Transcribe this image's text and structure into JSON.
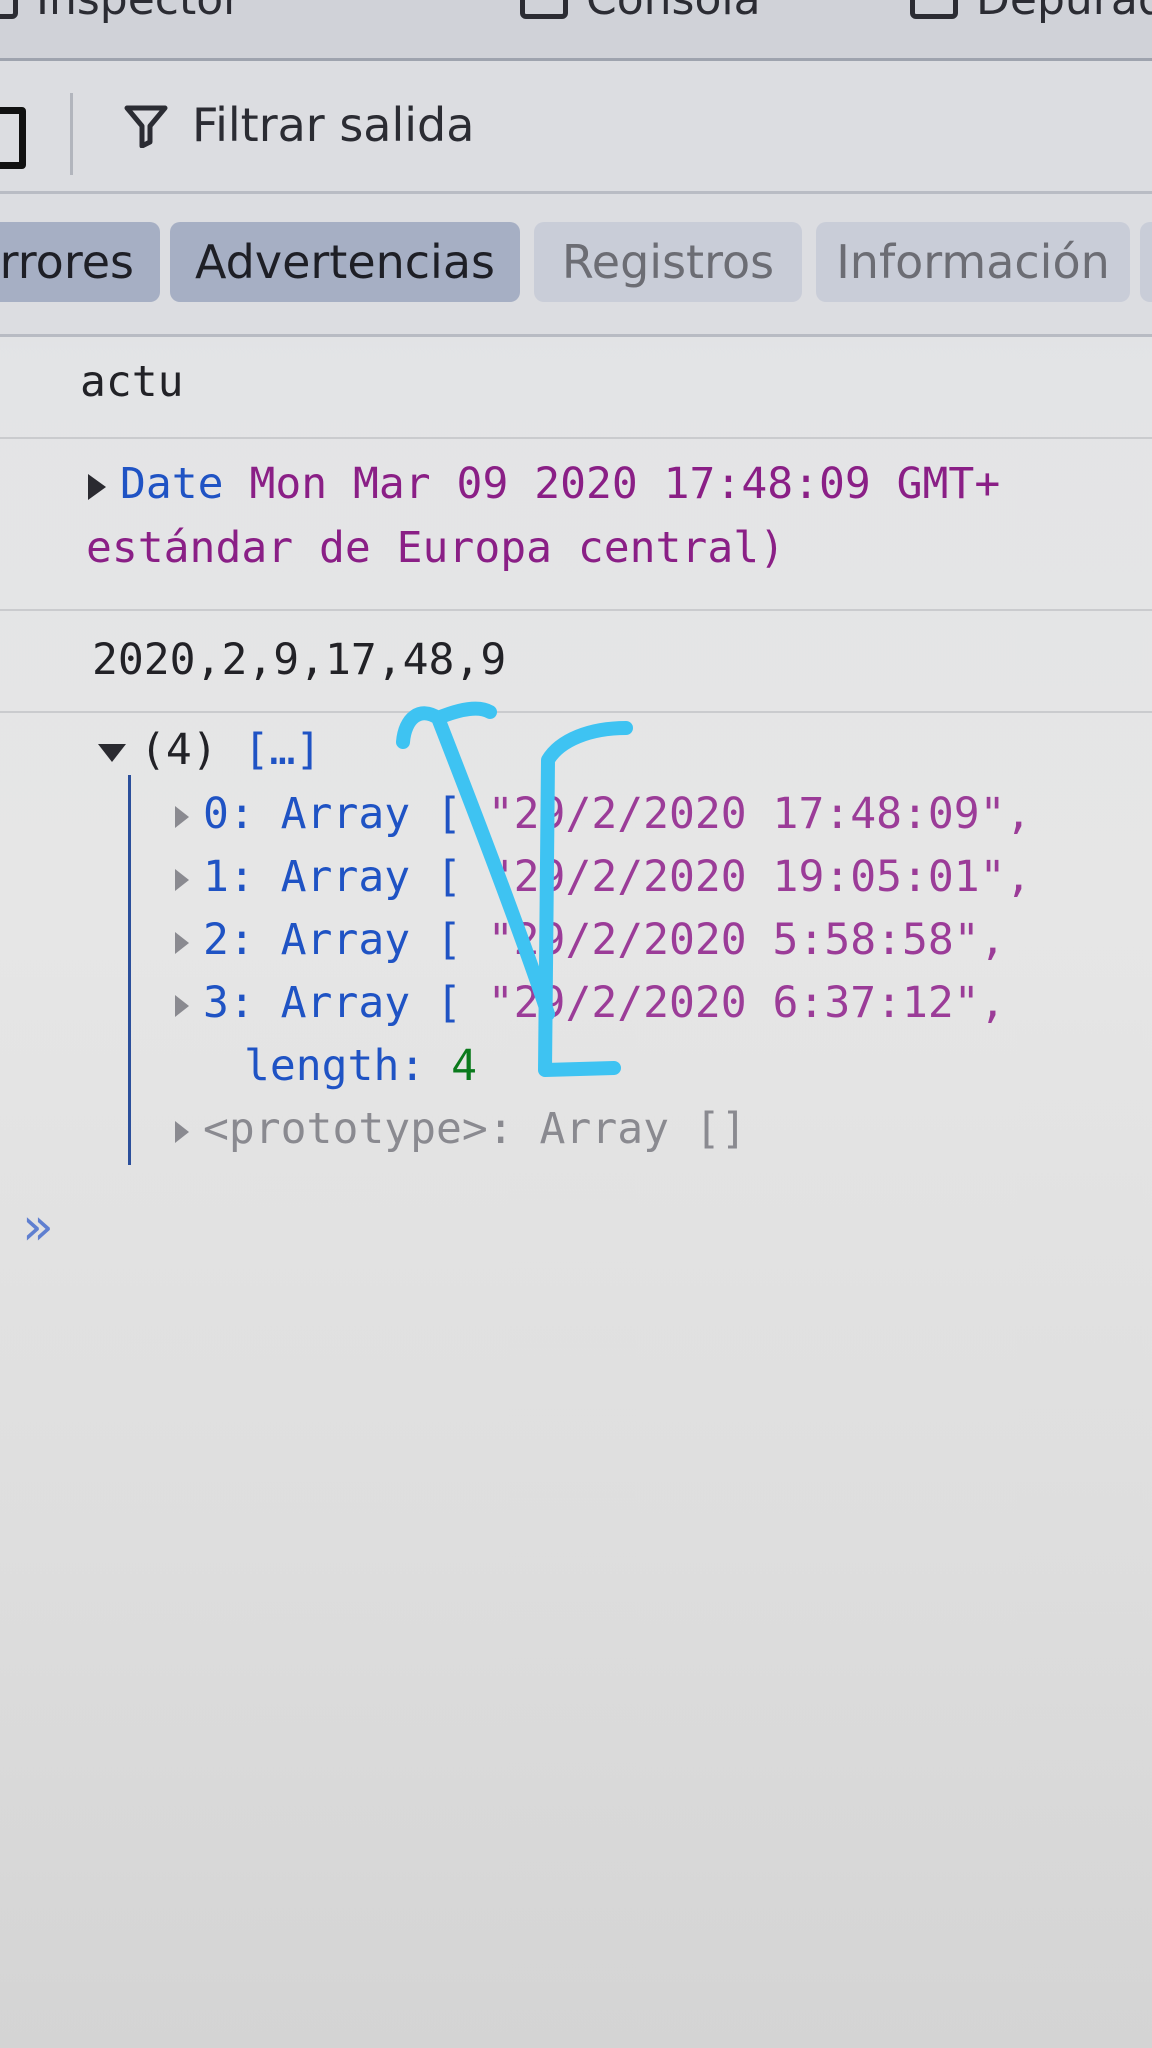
{
  "devtools_tabs": [
    {
      "label": "Inspector"
    },
    {
      "label": "Consola"
    },
    {
      "label": "Depurador"
    }
  ],
  "toolbar": {
    "filter_label": "Filtrar salida"
  },
  "levels": [
    {
      "label": "rrores",
      "active": true
    },
    {
      "label": "Advertencias",
      "active": true
    },
    {
      "label": "Registros",
      "active": false
    },
    {
      "label": "Información",
      "active": false
    }
  ],
  "console": {
    "input_echo": "actu",
    "date_object": {
      "type_label": "Date",
      "value_line1": "Mon Mar 09 2020 17:48:09 GMT+",
      "value_line2": "estándar de Europa central)"
    },
    "array_output": "2020,2,9,17,48,9",
    "array_tree": {
      "header_count": "(4)",
      "header_preview": "[…]",
      "items": [
        {
          "key": "0: Array [",
          "value": "\"29/2/2020 17:48:09\","
        },
        {
          "key": "1: Array [",
          "value": "\"29/2/2020 19:05:01\","
        },
        {
          "key": "2: Array [",
          "value": "\"29/2/2020 5:58:58\","
        },
        {
          "key": "3: Array [",
          "value": "\"29/2/2020 6:37:12\","
        }
      ],
      "length_label": "length:",
      "length_value": "4",
      "prototype_label": "<prototype>: Array []"
    },
    "prompt_symbol": "»"
  },
  "annotation_color": "#3ec3f2"
}
